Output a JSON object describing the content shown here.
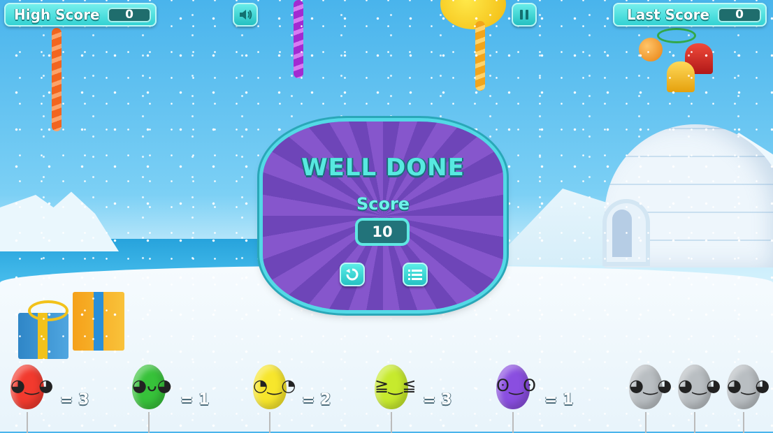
{
  "hud": {
    "high_score_label": "High Score",
    "high_score_value": "0",
    "last_score_label": "Last Score",
    "last_score_value": "0",
    "sound_icon": "speaker-icon",
    "pause_icon": "pause-icon"
  },
  "modal": {
    "title": "WELL DONE",
    "score_label": "Score",
    "score_value": "10",
    "replay_icon": "replay-icon",
    "menu_icon": "menu-list-icon"
  },
  "balloons": [
    {
      "color": "#f23a2e",
      "count_text": "= 3"
    },
    {
      "color": "#37c23a",
      "count_text": "= 1"
    },
    {
      "color": "#f7e62c",
      "count_text": "= 2"
    },
    {
      "color": "#c7ea2d",
      "count_text": "= 3"
    },
    {
      "color": "#8a4ee0",
      "count_text": "= 1"
    },
    {
      "color": "#b9bec2",
      "count_text": ""
    },
    {
      "color": "#b9bec2",
      "count_text": ""
    },
    {
      "color": "#b9bec2",
      "count_text": ""
    }
  ],
  "colors": {
    "accent": "#2fd0d1",
    "modal_purple": "#7a4fc4",
    "sky": "#49b4ec"
  }
}
